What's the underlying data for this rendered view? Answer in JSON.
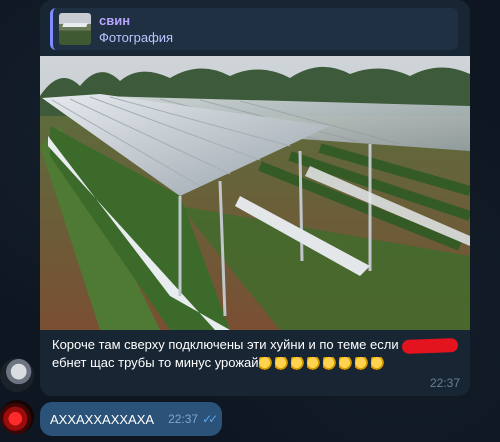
{
  "reply": {
    "author": "свин",
    "kind": "Фотография"
  },
  "message1": {
    "text_before": "Короче там сверху подключены эти хуйни и по теме если",
    "text_after": "ебнет щас трубы то минус урожай",
    "emoji_count": 8,
    "emoji_icon": "person-with-cane-emoji",
    "time": "22:37"
  },
  "message2": {
    "text": "АХХАХХАХХАХА",
    "time": "22:37",
    "status_icon": "double-check-icon"
  },
  "colors": {
    "background": "#0e1621",
    "incoming_bubble": "#182533",
    "outgoing_bubble": "#2b5278",
    "reply_bar": "#7f8cff",
    "redaction": "#e4141f"
  }
}
